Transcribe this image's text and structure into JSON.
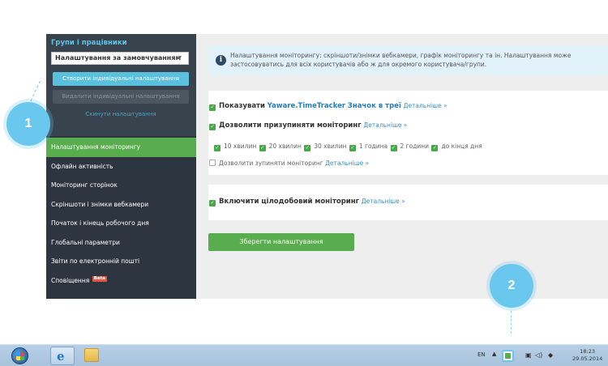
{
  "sidebar": {
    "title": "Групи і працівники",
    "select_value": "Налаштування за замовчуванням",
    "create_button": "Створити індивідуальні налаштування",
    "delete_button": "Видалити індивідуальні налаштування",
    "reset_link": "Скинути налаштування",
    "items": [
      {
        "label": "Налаштування моніторингу",
        "active": true
      },
      {
        "label": "Офлайн активність"
      },
      {
        "label": "Моніторинг сторінок"
      },
      {
        "label": "Скріншоти і знімки вебкамери"
      },
      {
        "label": "Початок і кінець робочого дня"
      },
      {
        "label": "Глобальні параметри"
      },
      {
        "label": "Звіти по електронній пошті"
      },
      {
        "label": "Сповіщення",
        "badge": "Beta"
      }
    ]
  },
  "main": {
    "info_text": "Налаштування моніторингу: скріншоти/знімки вебкамери, графік моніторингу та ін. Налаштування може застосовуватись для всіх користувачів або ж для окремого користувача/групи.",
    "show_tray": {
      "prefix": "Показувати",
      "brand": "Yaware.TimeTracker",
      "suffix": "Значок в треї",
      "more": "Детальніше »"
    },
    "allow_pause": {
      "label": "Дозволити призупиняти моніторинг",
      "more": "Детальніше »"
    },
    "pause_options": [
      "10 хвилин",
      "20 хвилин",
      "30 хвилин",
      "1 година",
      "2 години",
      "до кінця дня"
    ],
    "allow_stop": {
      "label": "Дозволити зупиняти моніторинг",
      "more": "Детальніше »"
    },
    "allday": {
      "label": "Включити цілодобовий моніторинг",
      "more": "Детальніше »"
    },
    "save_button": "Зберегти налаштування"
  },
  "markers": {
    "one": "1",
    "two": "2"
  },
  "taskbar": {
    "lang": "EN",
    "time": "18:23",
    "date": "29.05.2014"
  },
  "colors": {
    "accent_green": "#5aad4e",
    "accent_blue": "#5bc0de",
    "sidebar_bg": "#2d3640"
  }
}
